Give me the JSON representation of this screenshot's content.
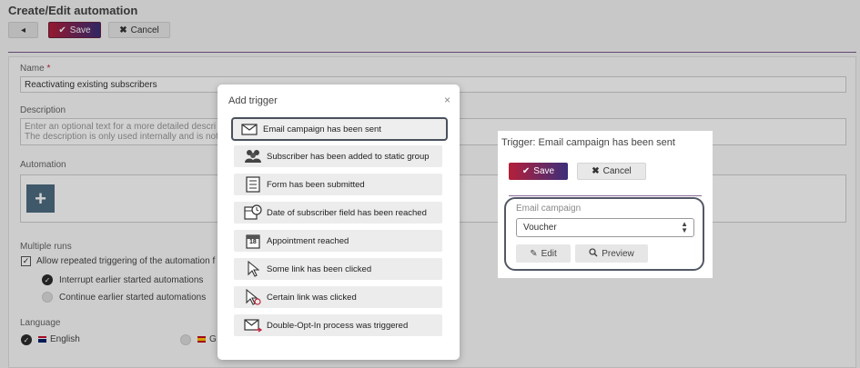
{
  "page": {
    "title": "Create/Edit automation",
    "toolbar": {
      "back_icon": "chevron-left-icon",
      "save_label": "Save",
      "cancel_label": "Cancel"
    }
  },
  "form": {
    "name_label": "Name",
    "name_required_mark": "*",
    "name_value": "Reactivating existing subscribers",
    "description_label": "Description",
    "description_placeholder_line1": "Enter an optional text for a more detailed descri",
    "description_placeholder_line2": "The description is only used internally and is not",
    "automation_label": "Automation",
    "add_symbol": "+",
    "multiple_runs_label": "Multiple runs",
    "allow_repeated_label": "Allow repeated triggering of the automation f",
    "interrupt_label": "Interrupt earlier started automations",
    "continue_label": "Continue earlier started automations",
    "language_label": "Language",
    "lang_english": "English",
    "lang_second": "G"
  },
  "modal": {
    "title": "Add trigger",
    "close": "×",
    "triggers": [
      {
        "label": "Email campaign has been sent",
        "icon": "envelope-icon"
      },
      {
        "label": "Subscriber has been added to static group",
        "icon": "users-group-icon"
      },
      {
        "label": "Form has been submitted",
        "icon": "form-icon"
      },
      {
        "label": "Date of subscriber field has been reached",
        "icon": "calendar-clock-icon"
      },
      {
        "label": "Appointment reached",
        "icon": "calendar-icon",
        "calendar_day": "18"
      },
      {
        "label": "Some link has been clicked",
        "icon": "cursor-icon"
      },
      {
        "label": "Certain link was clicked",
        "icon": "cursor-target-icon"
      },
      {
        "label": "Double-Opt-In process was triggered",
        "icon": "envelope-arrow-icon"
      }
    ]
  },
  "trigger_panel": {
    "title": "Trigger: Email campaign has been sent",
    "save_label": "Save",
    "cancel_label": "Cancel",
    "campaign_label": "Email campaign",
    "campaign_value": "Voucher",
    "edit_label": "Edit",
    "preview_label": "Preview"
  },
  "colors": {
    "brand_gradient_start": "#b51f3a",
    "brand_gradient_end": "#3b2f7a",
    "accent_button": "#4f6d82"
  }
}
